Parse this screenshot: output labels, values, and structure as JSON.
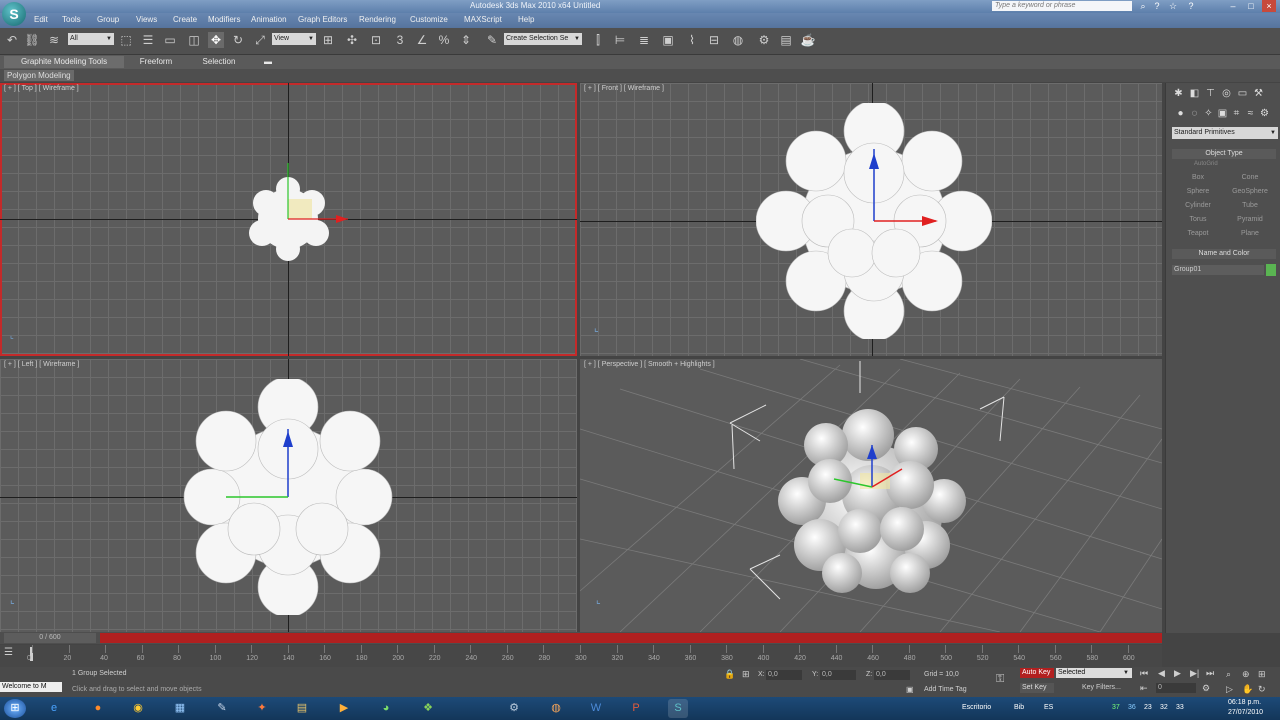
{
  "title_bar": {
    "title": "Autodesk 3ds Max  2010 x64          Untitled",
    "search_placeholder": "Type a keyword or phrase"
  },
  "menu": {
    "items": [
      "Edit",
      "Tools",
      "Group",
      "Views",
      "Create",
      "Modifiers",
      "Animation",
      "Graph Editors",
      "Rendering",
      "Customize",
      "MAXScript",
      "Help"
    ]
  },
  "toolbar": {
    "selection_filter": "All",
    "ref_coord": "View",
    "named_selection": "Create Selection Se"
  },
  "ribbon": {
    "tabs": [
      "Graphite Modeling Tools",
      "Freeform",
      "Selection"
    ],
    "panel_label": "Polygon Modeling"
  },
  "viewports": {
    "top": "[ + ] [ Top ] [ Wireframe ]",
    "front": "[ + ] [ Front ] [ Wireframe ]",
    "left": "[ + ] [ Left ] [ Wireframe ]",
    "perspective": "[ + ] [ Perspective ] [ Smooth + Highlights ]"
  },
  "command_panel": {
    "category": "Standard Primitives",
    "object_type_header": "Object Type",
    "autogrid": "AutoGrid",
    "buttons": [
      "Box",
      "Cone",
      "Sphere",
      "GeoSphere",
      "Cylinder",
      "Tube",
      "Torus",
      "Pyramid",
      "Teapot",
      "Plane"
    ],
    "name_color_header": "Name and Color",
    "object_name": "Group01",
    "object_color": "#5ab552"
  },
  "timeline": {
    "time_slider": "0 / 600",
    "ticks": [
      "0",
      "20",
      "40",
      "60",
      "80",
      "100",
      "120",
      "140",
      "160",
      "180",
      "200",
      "220",
      "240",
      "260",
      "280",
      "300",
      "320",
      "340",
      "360",
      "380",
      "400",
      "420",
      "440",
      "460",
      "480",
      "500",
      "520",
      "540",
      "560",
      "580",
      "600"
    ]
  },
  "status": {
    "maxscript": "Welcome to M",
    "selection": "1 Group Selected",
    "prompt": "Click and drag to select and move objects",
    "x_label": "X:",
    "x_value": "0,0",
    "y_label": "Y:",
    "y_value": "0,0",
    "z_label": "Z:",
    "z_value": "0,0",
    "grid": "Grid = 10,0",
    "add_time_tag": "Add Time Tag",
    "auto_key": "Auto Key",
    "selected": "Selected",
    "set_key": "Set Key",
    "key_filters": "Key Filters...",
    "frame": "0"
  },
  "taskbar": {
    "desktop": "Escritorio",
    "lang": "ES",
    "tray_numbers": [
      "37",
      "36",
      "23",
      "32",
      "33"
    ],
    "bib": "Bib",
    "time": "06:18 p.m.",
    "date": "27/07/2010"
  },
  "colors": {
    "active_viewport_border": "#c42a2a",
    "auto_key": "#b22020",
    "title_bar": "#6f8fb8",
    "taskbar": "#1a4470"
  }
}
